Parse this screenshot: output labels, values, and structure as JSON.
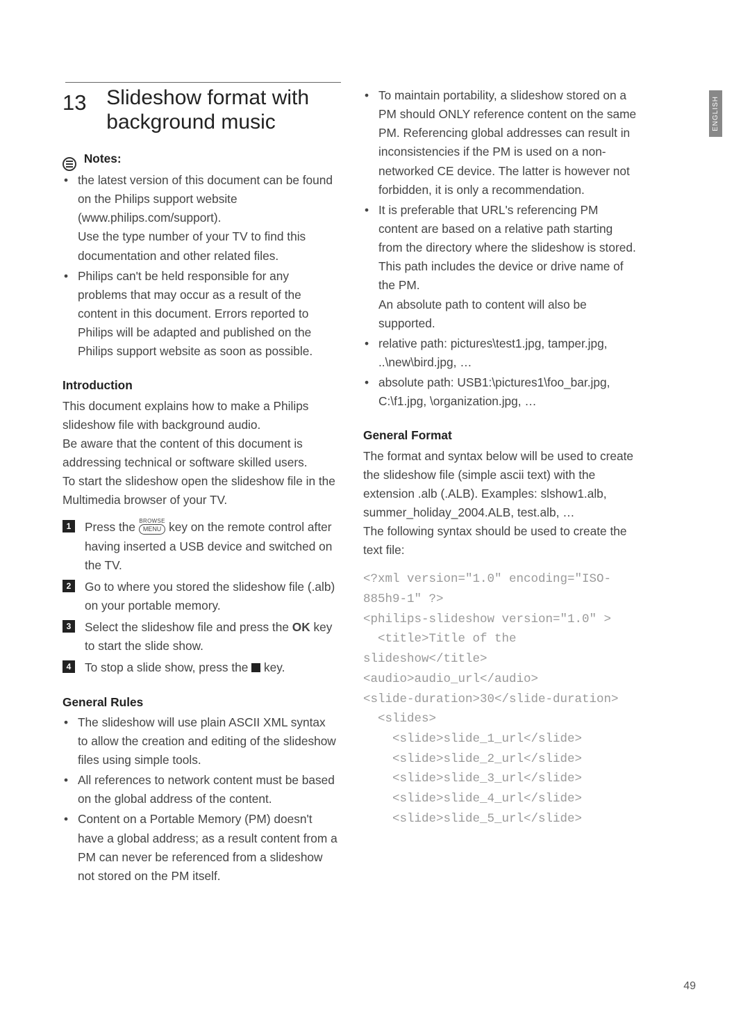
{
  "lang_tab": "ENGLISH",
  "heading": {
    "num": "13",
    "title_l1": "Slideshow format with",
    "title_l2": "background music"
  },
  "notes_label": "Notes:",
  "notes": {
    "b1a": "the latest version of this document can be found on the Philips support website (www.philips.com/support).",
    "b1b": "Use the type number of your TV to find this documentation and other related files.",
    "b2": "Philips can't be held responsible for any problems that may occur as a result of the content in this document.  Errors reported to Philips will be adapted and published on the Philips support website as soon as possible."
  },
  "intro_hdr": "Introduction",
  "intro_p1": "This document explains how to make a Philips slideshow file with background audio.",
  "intro_p2": "Be aware that the content of this document is addressing technical or software skilled users.",
  "intro_p3": "To start the slideshow open the slideshow file in the Multimedia browser of your TV.",
  "steps": {
    "browse": "BROWSE",
    "menu": "MENU",
    "s1a": "Press the ",
    "s1b": " key on the remote control after having inserted a USB device and switched on the TV.",
    "s2": "Go to where you stored the slideshow file (.alb) on your portable memory.",
    "s3a": "Select the slideshow file and press the ",
    "s3_ok": "OK",
    "s3b": " key to start the slide show.",
    "s4a": "To stop a slide show, press the ",
    "s4b": " key."
  },
  "rules_hdr": "General Rules",
  "rules": {
    "r1": "The slideshow will use plain ASCII XML syntax to allow the creation and editing of the slideshow files using simple tools.",
    "r2": "All references to network content must be based on the global address of the content.",
    "r3": "Content on a Portable Memory (PM) doesn't have a global address; as a result content from a PM can never be referenced from a slideshow not stored on the PM itself.",
    "r4": "To maintain portability, a slideshow stored on a PM should ONLY reference content on the same PM.  Referencing global addresses can result in inconsistencies if the PM is used on a non-networked CE device.  The latter is however not forbidden, it is only a recommendation.",
    "r5a": "It is preferable that URL's referencing PM content are based on a relative path starting from the directory where the slideshow is stored.  This path includes the device or drive name of the PM.",
    "r5b": "An absolute path to content will also be supported.",
    "r6": "relative path: pictures\\test1.jpg, tamper.jpg, ..\\new\\bird.jpg, …",
    "r7": "absolute path: USB1:\\pictures1\\foo_bar.jpg, C:\\f1.jpg, \\organization.jpg, …"
  },
  "format_hdr": "General Format",
  "format_p1": "The format and syntax below will be used to create the slideshow file (simple ascii text) with the extension .alb (.ALB). Examples: slshow1.alb, summer_holiday_2004.ALB, test.alb, …",
  "format_p2": "The following syntax should be used to create the text file:",
  "xml_code": "<?xml version=\"1.0\" encoding=\"ISO-885h9-1\" ?>\n<philips-slideshow version=\"1.0\" >\n  <title>Title of the slideshow</title>\n<audio>audio_url</audio>\n<slide-duration>30</slide-duration>\n  <slides>\n    <slide>slide_1_url</slide>\n    <slide>slide_2_url</slide>\n    <slide>slide_3_url</slide>\n    <slide>slide_4_url</slide>\n    <slide>slide_5_url</slide>",
  "page_num": "49"
}
